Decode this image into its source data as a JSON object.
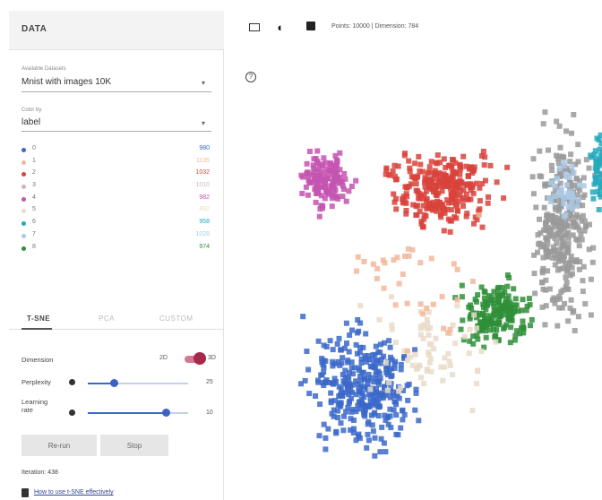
{
  "panel": {
    "title": "DATA",
    "dataset_label": "Available Datasets",
    "dataset_value": "Mnist with images 10K",
    "color_label": "Color by",
    "color_value": "label"
  },
  "legend": [
    {
      "label": "0",
      "count": "980",
      "color": "#3b68c9"
    },
    {
      "label": "1",
      "count": "1135",
      "color": "#f2b79b"
    },
    {
      "label": "2",
      "count": "1032",
      "color": "#d8433b"
    },
    {
      "label": "3",
      "count": "1010",
      "color": "#c9b7c6"
    },
    {
      "label": "4",
      "count": "982",
      "color": "#c454b0"
    },
    {
      "label": "5",
      "count": "892",
      "color": "#e9dcc9"
    },
    {
      "label": "6",
      "count": "958",
      "color": "#25a9bd"
    },
    {
      "label": "7",
      "count": "1028",
      "color": "#a9c9e4"
    },
    {
      "label": "8",
      "count": "974",
      "color": "#2f8f38"
    }
  ],
  "tabs": [
    {
      "label": "T-SNE",
      "active": true
    },
    {
      "label": "PCA",
      "active": false
    },
    {
      "label": "CUSTOM",
      "active": false
    }
  ],
  "controls": {
    "dimension_label": "Dimension",
    "dim_a": "2D",
    "dim_b": "3D",
    "perplexity_label": "Perplexity",
    "perplexity_value": "25",
    "perplexity_fraction": 0.26,
    "learning_label_1": "Learning",
    "learning_label_2": "rate",
    "learning_value": "10",
    "learning_fraction": 0.78,
    "rerun_label": "Re-run",
    "stop_label": "Stop",
    "iteration_text": "Iteration: 438",
    "howto_text": "How to use t-SNE effectively"
  },
  "toolbar": {
    "points_text": "Points: 10000 | Dimension: 784"
  }
}
